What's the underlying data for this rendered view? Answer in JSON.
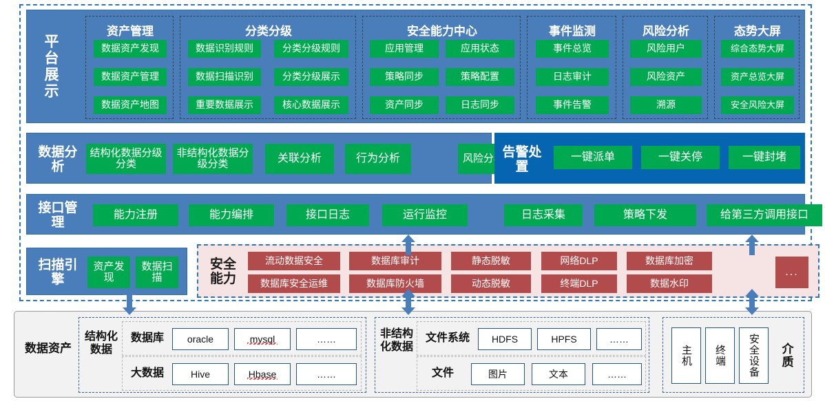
{
  "colors": {
    "blue_panel": "#4A7EBB",
    "dark_blue_panel": "#0565B0",
    "green_chip": "#00A94F",
    "red_chip": "#B24C4C",
    "security_panel_bg": "#F6E4E4",
    "asset_panel_bg": "#F2F2F2",
    "dash_border": "#2E75B6",
    "arrow": "#4A7EBB"
  },
  "rows": {
    "platform": {
      "label": "平台展示",
      "groups": [
        {
          "title": "资产管理",
          "columns": [
            [
              "数据资产发现",
              "数据资产管理",
              "数据资产地图"
            ]
          ]
        },
        {
          "title": "分类分级",
          "columns": [
            [
              "数据识别规则",
              "数据扫描识别",
              "重要数据展示"
            ],
            [
              "分类分级规则",
              "分类分级展示",
              "核心数据展示"
            ]
          ]
        },
        {
          "title": "安全能力中心",
          "columns": [
            [
              "应用管理",
              "策略同步",
              "资产同步"
            ],
            [
              "应用状态",
              "策略配置",
              "日志同步"
            ]
          ]
        },
        {
          "title": "事件监测",
          "columns": [
            [
              "事件总览",
              "日志审计",
              "事件告警"
            ]
          ]
        },
        {
          "title": "风险分析",
          "columns": [
            [
              "风险用户",
              "风险资产",
              "溯源"
            ]
          ]
        },
        {
          "title": "态势大屏",
          "columns": [
            [
              "综合态势大屏",
              "资产总览大屏",
              "安全风险大屏"
            ]
          ]
        }
      ]
    },
    "analysis": {
      "label": "数据分析",
      "items": [
        "结构化数据分级分类",
        "非结构化数据分级分类",
        "关联分析",
        "行为分析",
        "风险分析"
      ]
    },
    "alarm": {
      "label": "告警处置",
      "items": [
        "一键派单",
        "一键关停",
        "一键封堵"
      ]
    },
    "interface": {
      "label": "接口管理",
      "items": [
        "能力注册",
        "能力编排",
        "接口日志",
        "运行监控",
        "日志采集",
        "策略下发",
        "给第三方调用接口"
      ]
    },
    "scan_engine": {
      "label": "扫描引擎",
      "items": [
        "资产发现",
        "数据扫描"
      ]
    },
    "security": {
      "label": "安全能力",
      "columns": [
        [
          "流动数据安全",
          "数据库安全运维"
        ],
        [
          "数据库审计",
          "数据库防火墙"
        ],
        [
          "静态脱敏",
          "动态脱敏"
        ],
        [
          "网络DLP",
          "终端DLP"
        ],
        [
          "数据库加密",
          "数据水印"
        ]
      ],
      "more": "..."
    },
    "data_asset": {
      "label": "数据资产",
      "structured": {
        "label": "结构化数据",
        "rows": [
          {
            "name": "数据库",
            "items": [
              "oracle",
              "mysql",
              "……"
            ]
          },
          {
            "name": "大数据",
            "items": [
              "Hive",
              "Hbase",
              "……"
            ]
          }
        ]
      },
      "unstructured": {
        "label": "非结构化数据",
        "rows": [
          {
            "name": "文件系统",
            "items": [
              "HDFS",
              "HPFS",
              "……"
            ]
          },
          {
            "name": "文件",
            "items": [
              "图片",
              "文本",
              "……"
            ]
          }
        ]
      },
      "media": {
        "label": "介质",
        "items": [
          "主机",
          "终端",
          "安全设备"
        ]
      }
    }
  }
}
